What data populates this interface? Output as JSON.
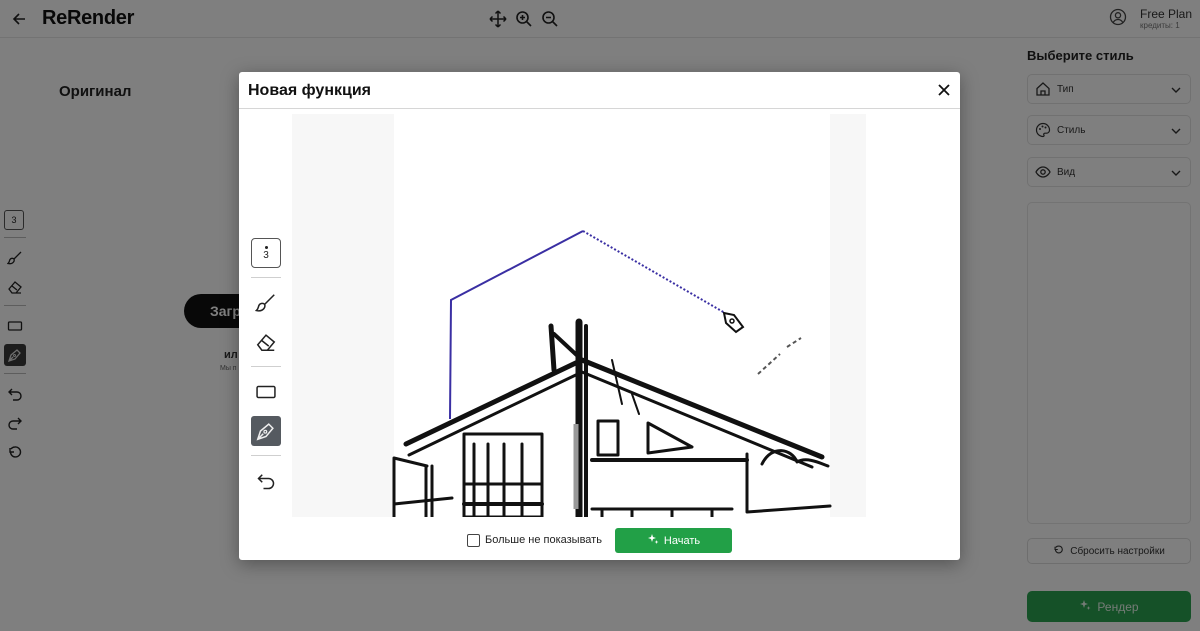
{
  "header": {
    "logo": "ReRender",
    "plan": "Free Plan",
    "credits": "кредиты: 1"
  },
  "left_toolbar": {
    "badge": "3",
    "tools": [
      "brush-icon",
      "eraser-icon",
      "rectangle-icon",
      "pen-icon",
      "undo-icon",
      "redo-icon",
      "reset-icon"
    ]
  },
  "main": {
    "original_title": "Оригинал",
    "upload_label": "Загр",
    "or_label": "ил",
    "hint": "Мы п"
  },
  "right_panel": {
    "title": "Выберите стиль",
    "dropdowns": [
      {
        "icon": "home-icon",
        "label": "Тип"
      },
      {
        "icon": "palette-icon",
        "label": "Стиль"
      },
      {
        "icon": "eye-icon",
        "label": "Вид"
      }
    ],
    "reset_label": "Сбросить настройки",
    "render_label": "Рендер"
  },
  "modal": {
    "title": "Новая функция",
    "badge": "3",
    "checkbox_label": "Больше не показывать",
    "checkbox_checked": false,
    "start_label": "Начать",
    "colors": {
      "accent": "#22a047",
      "stroke": "#3a2fa3"
    }
  }
}
